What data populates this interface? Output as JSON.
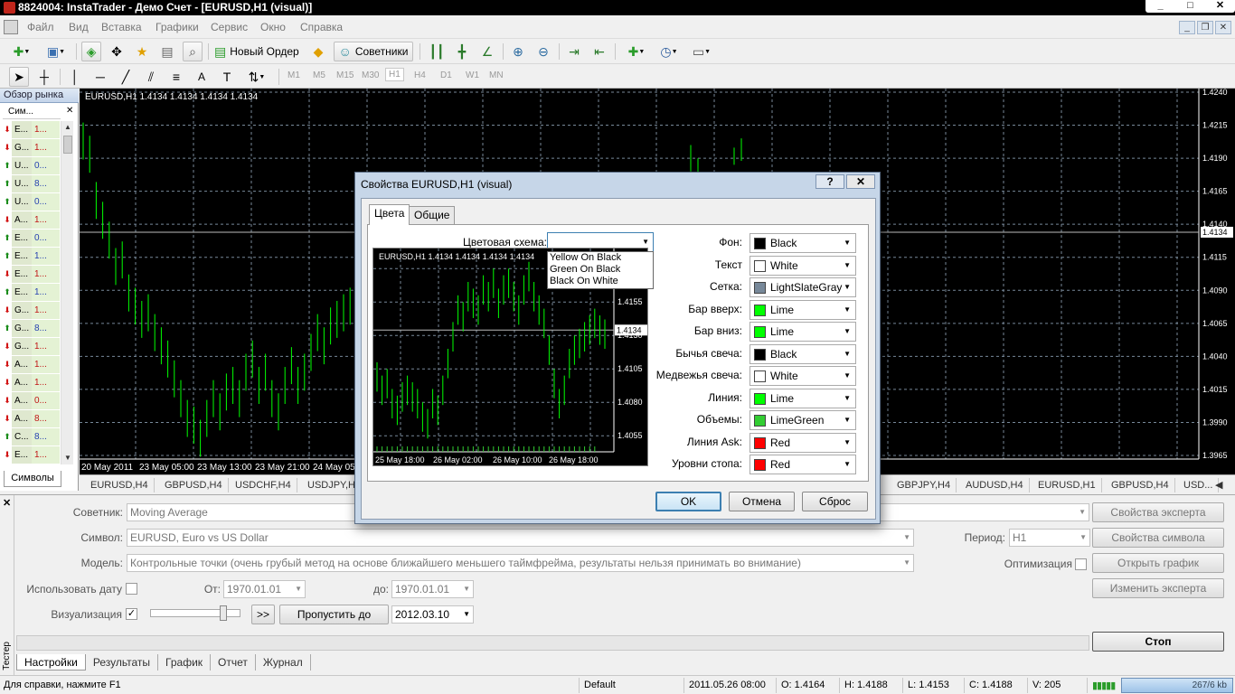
{
  "window": {
    "title": "8824004: InstaTrader - Демо Счет - [EURUSD,H1 (visual)]",
    "buttons": [
      "_",
      "□",
      "✕"
    ]
  },
  "menu": [
    "Файл",
    "Вид",
    "Вставка",
    "Графики",
    "Сервис",
    "Окно",
    "Справка"
  ],
  "toolbar": {
    "new_order": "Новый Ордер",
    "advisors": "Советники",
    "timeframes": [
      "M1",
      "M5",
      "M15",
      "M30",
      "H1",
      "H4",
      "D1",
      "W1",
      "MN"
    ],
    "active_timeframe": "H1"
  },
  "market_watch": {
    "title": "Обзор рынка",
    "col_symbol": "Сим...",
    "tab": "Символы",
    "rows": [
      {
        "sym": "E...",
        "bid": "1...",
        "dir": "down"
      },
      {
        "sym": "G...",
        "bid": "1...",
        "dir": "down"
      },
      {
        "sym": "U...",
        "bid": "0...",
        "dir": "up"
      },
      {
        "sym": "U...",
        "bid": "8...",
        "dir": "up"
      },
      {
        "sym": "U...",
        "bid": "0...",
        "dir": "up"
      },
      {
        "sym": "A...",
        "bid": "1...",
        "dir": "down"
      },
      {
        "sym": "E...",
        "bid": "0...",
        "dir": "up"
      },
      {
        "sym": "E...",
        "bid": "1...",
        "dir": "up"
      },
      {
        "sym": "E...",
        "bid": "1...",
        "dir": "down"
      },
      {
        "sym": "E...",
        "bid": "1...",
        "dir": "up"
      },
      {
        "sym": "G...",
        "bid": "1...",
        "dir": "down"
      },
      {
        "sym": "G...",
        "bid": "8...",
        "dir": "up"
      },
      {
        "sym": "G...",
        "bid": "1...",
        "dir": "down"
      },
      {
        "sym": "A...",
        "bid": "1...",
        "dir": "down"
      },
      {
        "sym": "A...",
        "bid": "1...",
        "dir": "down"
      },
      {
        "sym": "A...",
        "bid": "0...",
        "dir": "down"
      },
      {
        "sym": "A...",
        "bid": "8...",
        "dir": "down"
      },
      {
        "sym": "C...",
        "bid": "8...",
        "dir": "up"
      },
      {
        "sym": "E...",
        "bid": "1...",
        "dir": "down"
      }
    ]
  },
  "chart": {
    "header": "EURUSD,H1  1.4134 1.4134 1.4134 1.4134",
    "price_labels": [
      "1.4240",
      "1.4215",
      "1.4190",
      "1.4165",
      "1.4140",
      "1.4115",
      "1.4090",
      "1.4065",
      "1.4040",
      "1.4015",
      "1.3990",
      "1.3965"
    ],
    "current_price": "1.4134",
    "time_labels": [
      "20 May 2011",
      "23 May 05:00",
      "23 May 13:00",
      "23 May 21:00",
      "24 May 05"
    ]
  },
  "chart_tabs": [
    "EURUSD,H4",
    "GBPUSD,H4",
    "USDCHF,H4",
    "USDJPY,H4",
    "GBPJPY,H4",
    "AUDUSD,H4",
    "EURUSD,H1",
    "GBPUSD,H4",
    "USD..."
  ],
  "dialog": {
    "title": "Свойства EURUSD,H1 (visual)",
    "help_button": "?",
    "close_button": "✕",
    "tabs": [
      "Цвета",
      "Общие"
    ],
    "scheme_label": "Цветовая схема:",
    "scheme_options": [
      "Yellow On Black",
      "Green On Black",
      "Black On White"
    ],
    "preview": {
      "header": "EURUSD,H1  1.4134 1.4134 1.4134 1.4134",
      "price_labels": [
        "1.4180",
        "1.4155",
        "1.4130",
        "1.4105",
        "1.4080",
        "1.4055"
      ],
      "current_price": "1.4134",
      "time_labels": [
        "25 May 18:00",
        "26 May 02:00",
        "26 May 10:00",
        "26 May 18:00"
      ]
    },
    "colors": [
      {
        "label": "Фон:",
        "value": "Black",
        "swatch": "#000000"
      },
      {
        "label": "Текст",
        "value": "White",
        "swatch": "#ffffff"
      },
      {
        "label": "Сетка:",
        "value": "LightSlateGray",
        "swatch": "#778899"
      },
      {
        "label": "Бар вверх:",
        "value": "Lime",
        "swatch": "#00ff00"
      },
      {
        "label": "Бар вниз:",
        "value": "Lime",
        "swatch": "#00ff00"
      },
      {
        "label": "Бычья свеча:",
        "value": "Black",
        "swatch": "#000000"
      },
      {
        "label": "Медвежья свеча:",
        "value": "White",
        "swatch": "#ffffff"
      },
      {
        "label": "Линия:",
        "value": "Lime",
        "swatch": "#00ff00"
      },
      {
        "label": "Объемы:",
        "value": "LimeGreen",
        "swatch": "#32cd32"
      },
      {
        "label": "Линия Ask:",
        "value": "Red",
        "swatch": "#ff0000"
      },
      {
        "label": "Уровни стопа:",
        "value": "Red",
        "swatch": "#ff0000"
      }
    ],
    "ok": "OK",
    "cancel": "Отмена",
    "reset": "Сброс"
  },
  "tester": {
    "side_label": "Тестер",
    "advisor_label": "Советник:",
    "advisor_value": "Moving Average",
    "symbol_label": "Символ:",
    "symbol_value": "EURUSD, Euro vs US Dollar",
    "period_label": "Период:",
    "period_value": "H1",
    "model_label": "Модель:",
    "model_value": "Контрольные точки (очень грубый метод на основе ближайшего меньшего таймфрейма, результаты нельзя принимать во внимание)",
    "optimization_label": "Оптимизация",
    "use_date_label": "Использовать дату",
    "from_label": "От:",
    "from_value": "1970.01.01",
    "to_label": "до:",
    "to_value": "1970.01.01",
    "visualization_label": "Визуализация",
    "ff_button": ">>",
    "skip_to_button": "Пропустить до",
    "skip_to_value": "2012.03.10",
    "btn_expert_props": "Свойства эксперта",
    "btn_symbol_props": "Свойства символа",
    "btn_open_chart": "Открыть график",
    "btn_modify_expert": "Изменить эксперта",
    "btn_stop": "Стоп",
    "tabs": [
      "Настройки",
      "Результаты",
      "График",
      "Отчет",
      "Журнал"
    ]
  },
  "status": {
    "help": "Для справки, нажмите F1",
    "profile": "Default",
    "datetime": "2011.05.26 08:00",
    "open": "O: 1.4164",
    "high": "H: 1.4188",
    "low": "L: 1.4153",
    "close": "C: 1.4188",
    "volume": "V: 205",
    "net": "267/6 kb"
  }
}
